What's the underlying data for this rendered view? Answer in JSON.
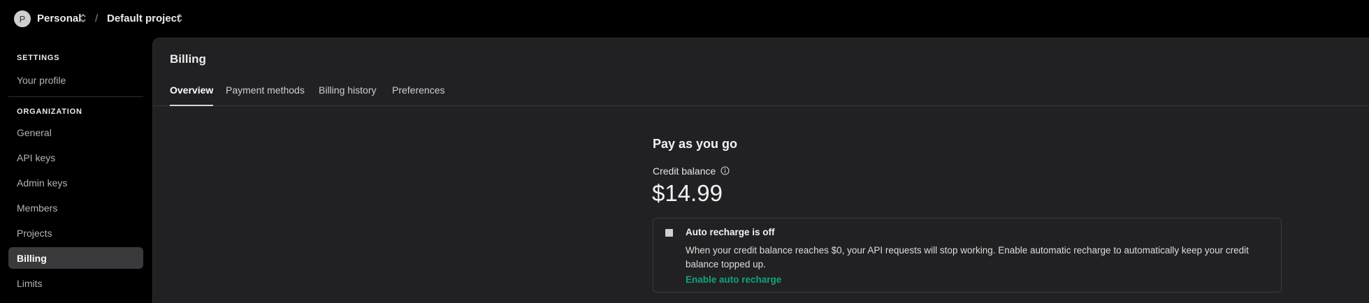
{
  "topbar": {
    "avatar_initial": "P",
    "org_name": "Personal",
    "separator": "/",
    "project_name": "Default project"
  },
  "sidebar": {
    "settings_heading": "SETTINGS",
    "settings_items": [
      {
        "label": "Your profile"
      }
    ],
    "organization_heading": "ORGANIZATION",
    "org_items": [
      {
        "label": "General"
      },
      {
        "label": "API keys"
      },
      {
        "label": "Admin keys"
      },
      {
        "label": "Members"
      },
      {
        "label": "Projects"
      },
      {
        "label": "Billing",
        "active": true
      },
      {
        "label": "Limits"
      }
    ]
  },
  "main": {
    "title": "Billing",
    "tabs": [
      {
        "label": "Overview",
        "active": true
      },
      {
        "label": "Payment methods"
      },
      {
        "label": "Billing history"
      },
      {
        "label": "Preferences"
      }
    ],
    "plan_title": "Pay as you go",
    "credit_label": "Credit balance",
    "credit_value": "$14.99",
    "recharge": {
      "title": "Auto recharge is off",
      "description": "When your credit balance reaches $0, your API requests will stop working. Enable automatic recharge to automatically keep your credit balance topped up.",
      "link_label": "Enable auto recharge"
    }
  },
  "colors": {
    "accent": "#10a37f",
    "panel_bg": "#212123",
    "page_bg": "#000000"
  },
  "icons": [
    "chevron-updown-icon",
    "info-icon"
  ]
}
